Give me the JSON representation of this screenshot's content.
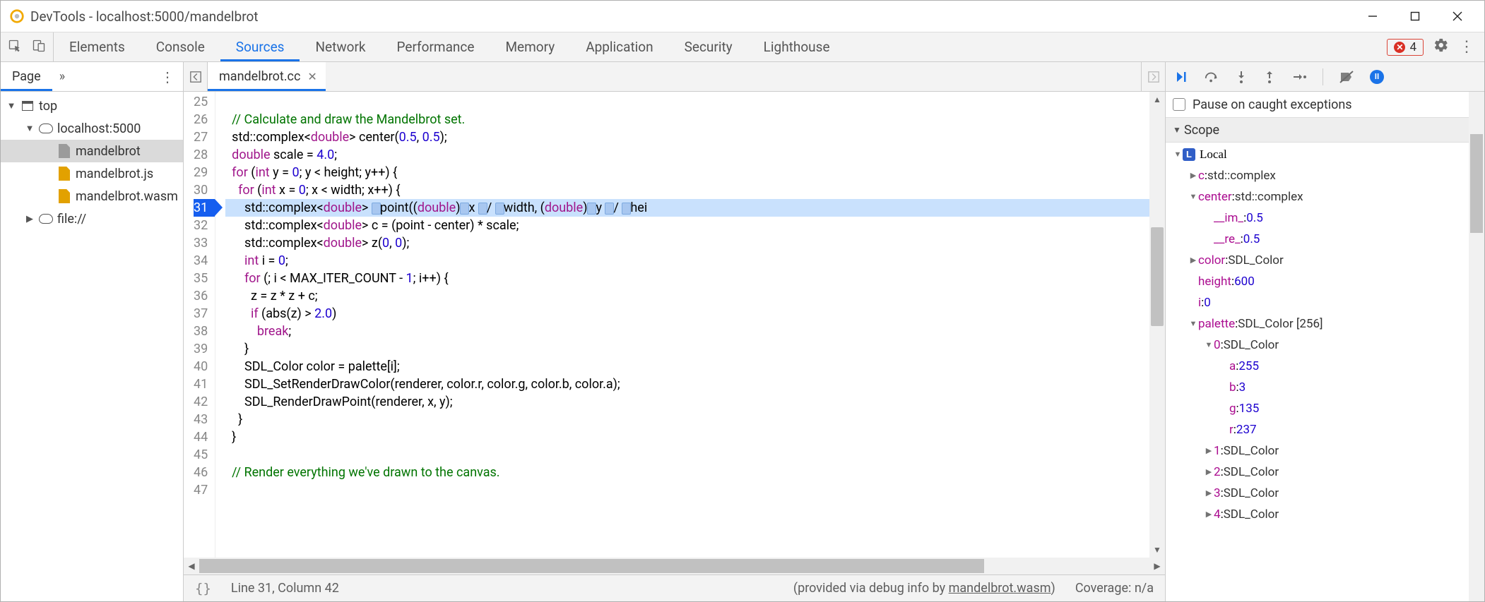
{
  "window": {
    "title": "DevTools - localhost:5000/mandelbrot"
  },
  "tabs": {
    "items": [
      "Elements",
      "Console",
      "Sources",
      "Network",
      "Performance",
      "Memory",
      "Application",
      "Security",
      "Lighthouse"
    ],
    "active": "Sources"
  },
  "errors": {
    "count": "4"
  },
  "navigator": {
    "header": "Page",
    "tree": [
      {
        "label": "top",
        "depth": 0,
        "icon": "window",
        "twisty": "▼"
      },
      {
        "label": "localhost:5000",
        "depth": 1,
        "icon": "cloud",
        "twisty": "▼"
      },
      {
        "label": "mandelbrot",
        "depth": 2,
        "icon": "file-gray",
        "selected": true
      },
      {
        "label": "mandelbrot.js",
        "depth": 2,
        "icon": "file"
      },
      {
        "label": "mandelbrot.wasm",
        "depth": 2,
        "icon": "file"
      },
      {
        "label": "file://",
        "depth": 1,
        "icon": "cloud",
        "twisty": "▶"
      }
    ]
  },
  "editor": {
    "filename": "mandelbrot.cc",
    "first_line": 25,
    "breakpoint_line": 31,
    "lines": [
      "",
      "  // Calculate and draw the Mandelbrot set.",
      "  std::complex<double> center(0.5, 0.5);",
      "  double scale = 4.0;",
      "  for (int y = 0; y < height; y++) {",
      "    for (int x = 0; x < width; x++) {",
      "      std::complex<double> point((double)x / width, (double)y / hei",
      "      std::complex<double> c = (point - center) * scale;",
      "      std::complex<double> z(0, 0);",
      "      int i = 0;",
      "      for (; i < MAX_ITER_COUNT - 1; i++) {",
      "        z = z * z + c;",
      "        if (abs(z) > 2.0)",
      "          break;",
      "      }",
      "      SDL_Color color = palette[i];",
      "      SDL_SetRenderDrawColor(renderer, color.r, color.g, color.b, color.a);",
      "      SDL_RenderDrawPoint(renderer, x, y);",
      "    }",
      "  }",
      "",
      "  // Render everything we've drawn to the canvas.",
      ""
    ]
  },
  "status": {
    "cursor": "Line 31, Column 42",
    "debug_prefix": "(provided via debug info by ",
    "debug_link": "mandelbrot.wasm",
    "debug_suffix": ")",
    "coverage": "Coverage: n/a"
  },
  "debugger": {
    "pause_caught": "Pause on caught exceptions",
    "scope_header": "Scope",
    "local_label": "Local",
    "vars": [
      {
        "indent": 1,
        "tw": "▶",
        "key": "c",
        "val": "std::complex<double>"
      },
      {
        "indent": 1,
        "tw": "▼",
        "key": "center",
        "val": "std::complex<double>"
      },
      {
        "indent": 2,
        "tw": "",
        "key": "__im_",
        "val": "0.5",
        "num": true
      },
      {
        "indent": 2,
        "tw": "",
        "key": "__re_",
        "val": "0.5",
        "num": true
      },
      {
        "indent": 1,
        "tw": "▶",
        "key": "color",
        "val": "SDL_Color"
      },
      {
        "indent": 1,
        "tw": "",
        "key": "height",
        "val": "600",
        "num": true
      },
      {
        "indent": 1,
        "tw": "",
        "key": "i",
        "val": "0",
        "num": true
      },
      {
        "indent": 1,
        "tw": "▼",
        "key": "palette",
        "val": "SDL_Color [256]"
      },
      {
        "indent": 2,
        "tw": "▼",
        "key": "0",
        "val": "SDL_Color"
      },
      {
        "indent": 3,
        "tw": "",
        "key": "a",
        "val": "255",
        "num": true
      },
      {
        "indent": 3,
        "tw": "",
        "key": "b",
        "val": "3",
        "num": true
      },
      {
        "indent": 3,
        "tw": "",
        "key": "g",
        "val": "135",
        "num": true
      },
      {
        "indent": 3,
        "tw": "",
        "key": "r",
        "val": "237",
        "num": true
      },
      {
        "indent": 2,
        "tw": "▶",
        "key": "1",
        "val": "SDL_Color"
      },
      {
        "indent": 2,
        "tw": "▶",
        "key": "2",
        "val": "SDL_Color"
      },
      {
        "indent": 2,
        "tw": "▶",
        "key": "3",
        "val": "SDL_Color"
      },
      {
        "indent": 2,
        "tw": "▶",
        "key": "4",
        "val": "SDL_Color"
      }
    ]
  }
}
